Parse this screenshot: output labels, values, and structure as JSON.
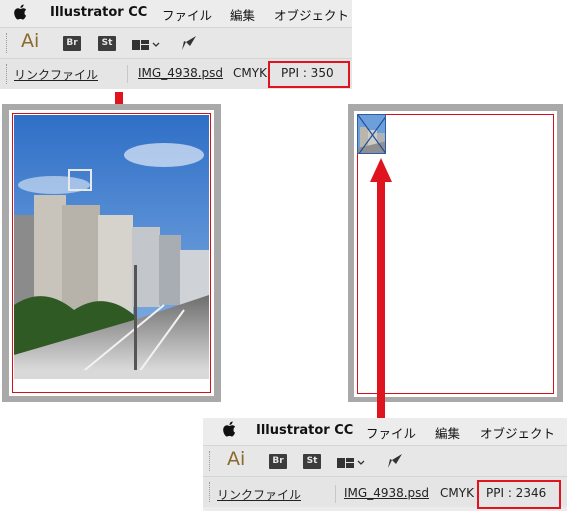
{
  "top_window": {
    "menu": {
      "app_name": "Illustrator CC",
      "file": "ファイル",
      "edit": "編集",
      "object": "オブジェクト"
    },
    "toolbar": {
      "ai_label": "Ai",
      "br_label": "Br",
      "st_label": "St"
    },
    "control": {
      "link_label": "リンクファイル",
      "filename": "IMG_4938.psd",
      "colormode": "CMYK",
      "ppi": "PPI : 350"
    }
  },
  "bottom_window": {
    "menu": {
      "app_name": "Illustrator CC",
      "file": "ファイル",
      "edit": "編集",
      "object": "オブジェクト"
    },
    "toolbar": {
      "ai_label": "Ai",
      "br_label": "Br",
      "st_label": "St"
    },
    "control": {
      "link_label": "リンクファイル",
      "filename": "IMG_4938.psd",
      "colormode": "CMYK",
      "ppi": "PPI : 2346"
    }
  },
  "colors": {
    "highlight": "#e0141e",
    "artboard_frame": "#a9a9a9",
    "sky": "#3f7fd0"
  },
  "icons": [
    "apple-icon",
    "workspace-icon",
    "chevron-down-icon",
    "gpu-rocket-icon",
    "street-photo",
    "arrow-down-icon",
    "arrow-up-icon"
  ]
}
